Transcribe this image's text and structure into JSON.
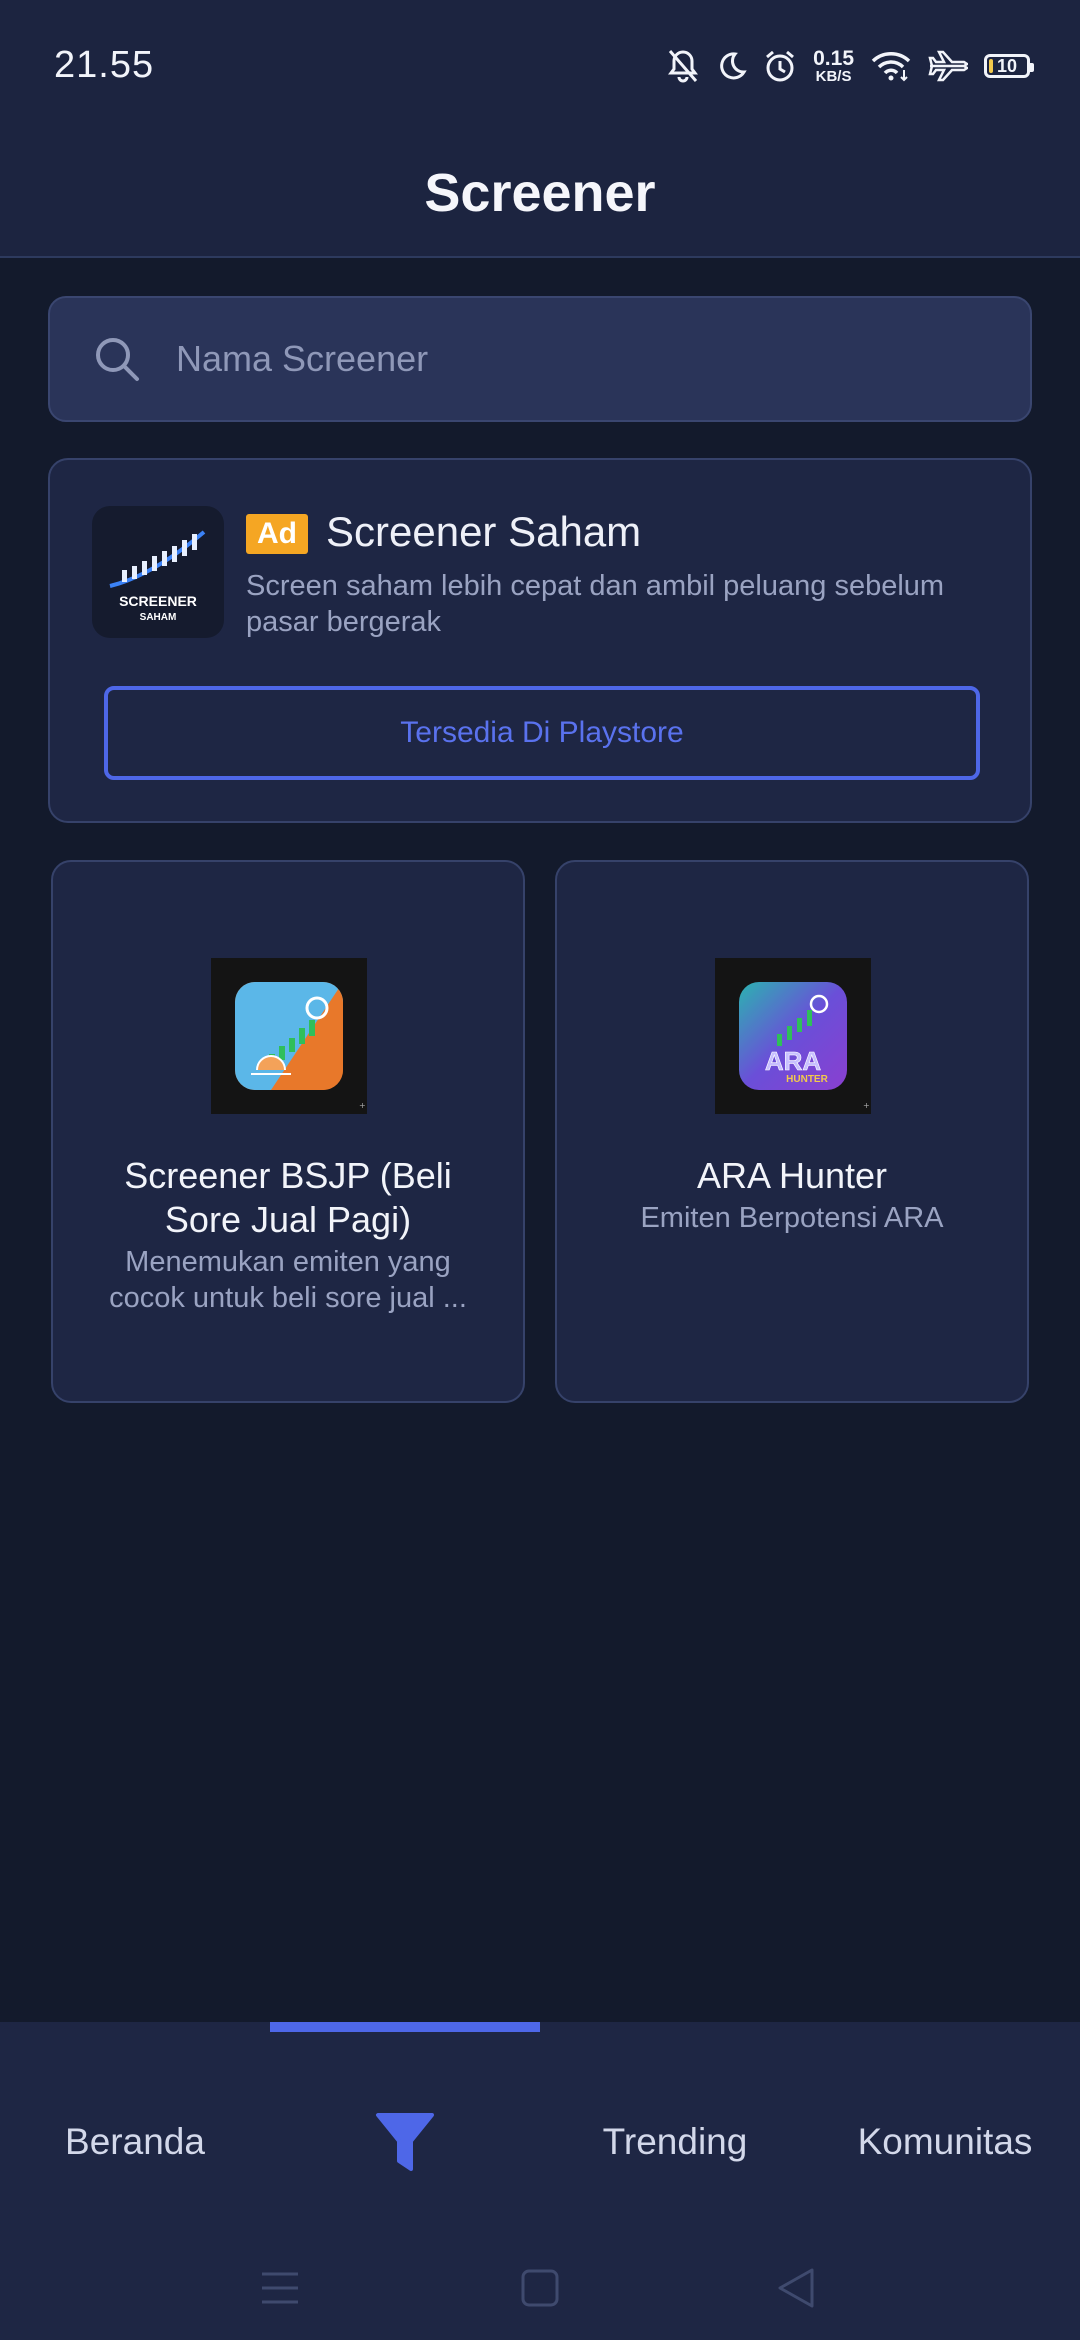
{
  "status_bar": {
    "time": "21.55",
    "net_speed_value": "0.15",
    "net_speed_unit": "KB/S",
    "battery": "10",
    "icons": [
      "bell-off-icon",
      "moon-icon",
      "alarm-icon",
      "wifi-icon",
      "airplane-icon",
      "battery-icon"
    ]
  },
  "header": {
    "title": "Screener"
  },
  "search": {
    "placeholder": "Nama Screener",
    "icon": "search-icon"
  },
  "ad": {
    "badge": "Ad",
    "title": "Screener Saham",
    "description": "Screen saham lebih cepat dan ambil peluang sebelum pasar bergerak",
    "cta": "Tersedia Di Playstore",
    "logo_text_1": "SCREENER",
    "logo_text_2": "SAHAM"
  },
  "screeners": [
    {
      "title": "Screener BSJP (Beli Sore Jual Pagi)",
      "subtitle": "Menemukan emiten yang cocok untuk beli sore jual ..."
    },
    {
      "title": "ARA Hunter",
      "subtitle": "Emiten Berpotensi ARA",
      "logo_text_1": "ARA",
      "logo_text_2": "HUNTER"
    }
  ],
  "bottom_nav": {
    "items": [
      {
        "label": "Beranda"
      },
      {
        "label": "",
        "icon": "filter-icon",
        "active": true
      },
      {
        "label": "Trending"
      },
      {
        "label": "Komunitas"
      }
    ]
  },
  "colors": {
    "accent": "#4e67e8",
    "background": "#131a2c",
    "surface": "#1e2644",
    "ad_badge": "#f5a623"
  }
}
